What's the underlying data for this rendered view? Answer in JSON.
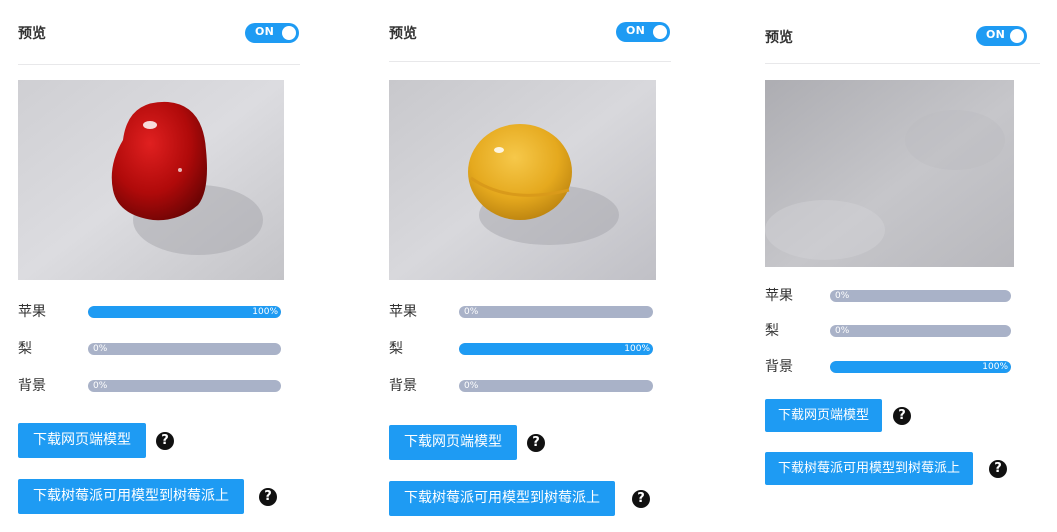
{
  "accent_color": "#1e9bf3",
  "track_color": "#a9b2c8",
  "panels": [
    {
      "header": {
        "title": "预览",
        "toggle": "ON"
      },
      "preview": {
        "object": "red apple on table"
      },
      "classes": [
        {
          "label": "苹果",
          "pct_text": "100%",
          "value": 1.0
        },
        {
          "label": "梨",
          "pct_text": "0%",
          "value": 0.0
        },
        {
          "label": "背景",
          "pct_text": "0%",
          "value": 0.0
        }
      ],
      "buttons": {
        "download_web": "下载网页端模型",
        "download_pi": "下载树莓派可用模型到树莓派上"
      },
      "help_icon": "?"
    },
    {
      "header": {
        "title": "预览",
        "toggle": "ON"
      },
      "preview": {
        "object": "yellow pear on table"
      },
      "classes": [
        {
          "label": "苹果",
          "pct_text": "0%",
          "value": 0.0
        },
        {
          "label": "梨",
          "pct_text": "100%",
          "value": 1.0
        },
        {
          "label": "背景",
          "pct_text": "0%",
          "value": 0.0
        }
      ],
      "buttons": {
        "download_web": "下载网页端模型",
        "download_pi": "下载树莓派可用模型到树莓派上"
      },
      "help_icon": "?"
    },
    {
      "header": {
        "title": "预览",
        "toggle": "ON"
      },
      "preview": {
        "object": "empty table background"
      },
      "classes": [
        {
          "label": "苹果",
          "pct_text": "0%",
          "value": 0.0
        },
        {
          "label": "梨",
          "pct_text": "0%",
          "value": 0.0
        },
        {
          "label": "背景",
          "pct_text": "100%",
          "value": 1.0
        }
      ],
      "buttons": {
        "download_web": "下载网页端模型",
        "download_pi": "下载树莓派可用模型到树莓派上"
      },
      "help_icon": "?"
    }
  ]
}
